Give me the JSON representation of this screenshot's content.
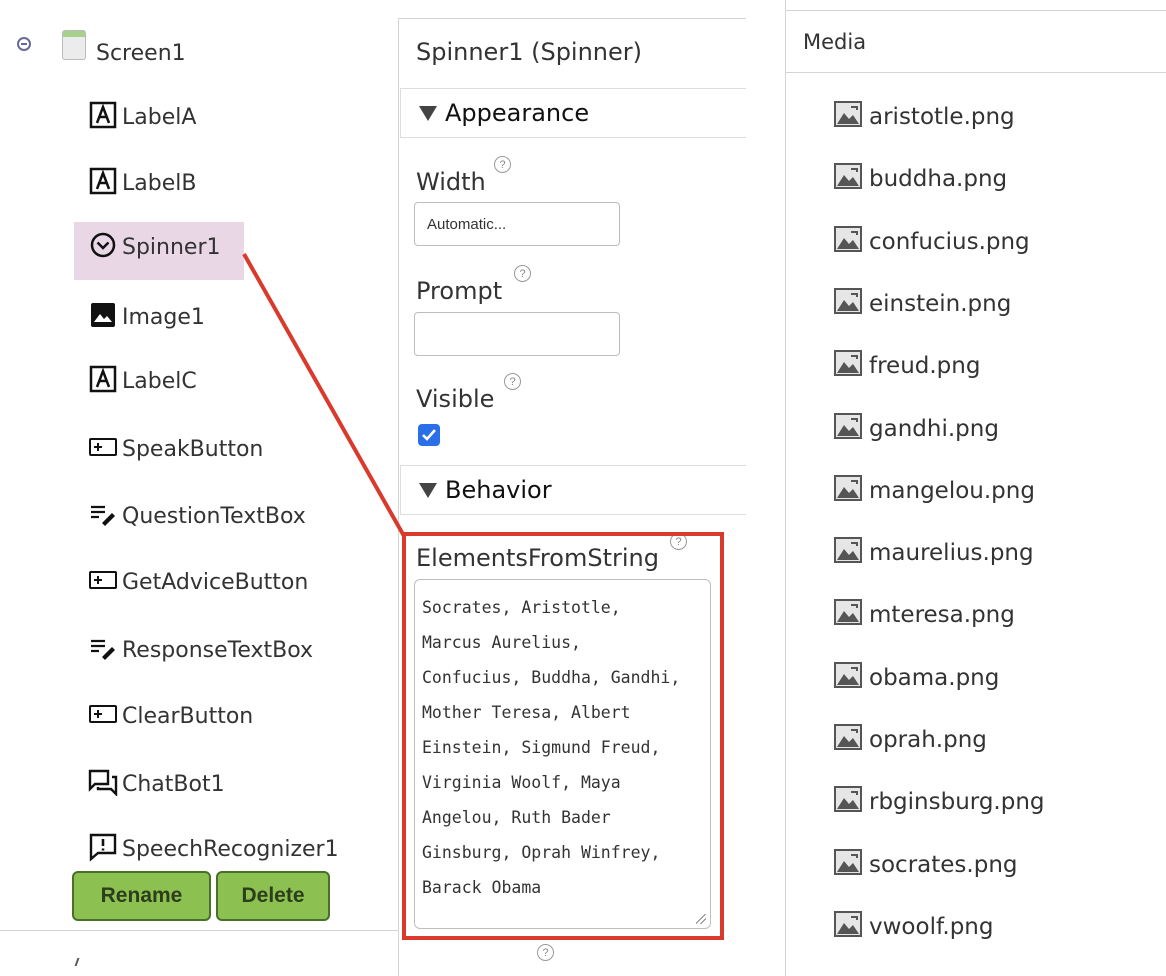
{
  "components": {
    "screen": {
      "label": "Screen1",
      "icon": "screen-icon"
    },
    "items": [
      {
        "label": "LabelA",
        "icon": "label-icon"
      },
      {
        "label": "LabelB",
        "icon": "label-icon"
      },
      {
        "label": "Spinner1",
        "icon": "spinner-icon",
        "selected": true
      },
      {
        "label": "Image1",
        "icon": "image-icon"
      },
      {
        "label": "LabelC",
        "icon": "label-icon"
      },
      {
        "label": "SpeakButton",
        "icon": "button-icon"
      },
      {
        "label": "QuestionTextBox",
        "icon": "textbox-icon"
      },
      {
        "label": "GetAdviceButton",
        "icon": "button-icon"
      },
      {
        "label": "ResponseTextBox",
        "icon": "textbox-icon"
      },
      {
        "label": "ClearButton",
        "icon": "button-icon"
      },
      {
        "label": "ChatBot1",
        "icon": "chatbot-icon"
      },
      {
        "label": "SpeechRecognizer1",
        "icon": "speech-recognizer-icon"
      }
    ],
    "rename_label": "Rename",
    "delete_label": "Delete"
  },
  "properties": {
    "title": "Spinner1 (Spinner)",
    "sections": {
      "appearance": "Appearance",
      "behavior": "Behavior"
    },
    "width": {
      "label": "Width",
      "value": "Automatic..."
    },
    "prompt": {
      "label": "Prompt",
      "value": ""
    },
    "visible": {
      "label": "Visible",
      "checked": true
    },
    "elements_from_string": {
      "label": "ElementsFromString",
      "value": "Socrates, Aristotle, Marcus Aurelius, Confucius, Buddha, Gandhi, Mother Teresa, Albert Einstein, Sigmund Freud, Virginia Woolf, Maya Angelou, Ruth Bader Ginsburg, Oprah Winfrey, Barack Obama",
      "display_lines": [
        "Socrates, Aristotle,",
        "Marcus Aurelius,",
        "Confucius, Buddha, Gandhi,",
        "Mother Teresa, Albert",
        "Einstein, Sigmund Freud,",
        "Virginia Woolf, Maya",
        "Angelou, Ruth Bader",
        "Ginsburg, Oprah Winfrey,",
        "Barack Obama"
      ]
    },
    "help_glyph": "?"
  },
  "media": {
    "title": "Media",
    "files": [
      "aristotle.png",
      "buddha.png",
      "confucius.png",
      "einstein.png",
      "freud.png",
      "gandhi.png",
      "mangelou.png",
      "maurelius.png",
      "mteresa.png",
      "obama.png",
      "oprah.png",
      "rbginsburg.png",
      "socrates.png",
      "vwoolf.png"
    ]
  },
  "colors": {
    "selection": "#ead7e5",
    "button_green": "#8cc152",
    "highlight_red": "#d93a2b",
    "checkbox_blue": "#2a6fe8"
  }
}
